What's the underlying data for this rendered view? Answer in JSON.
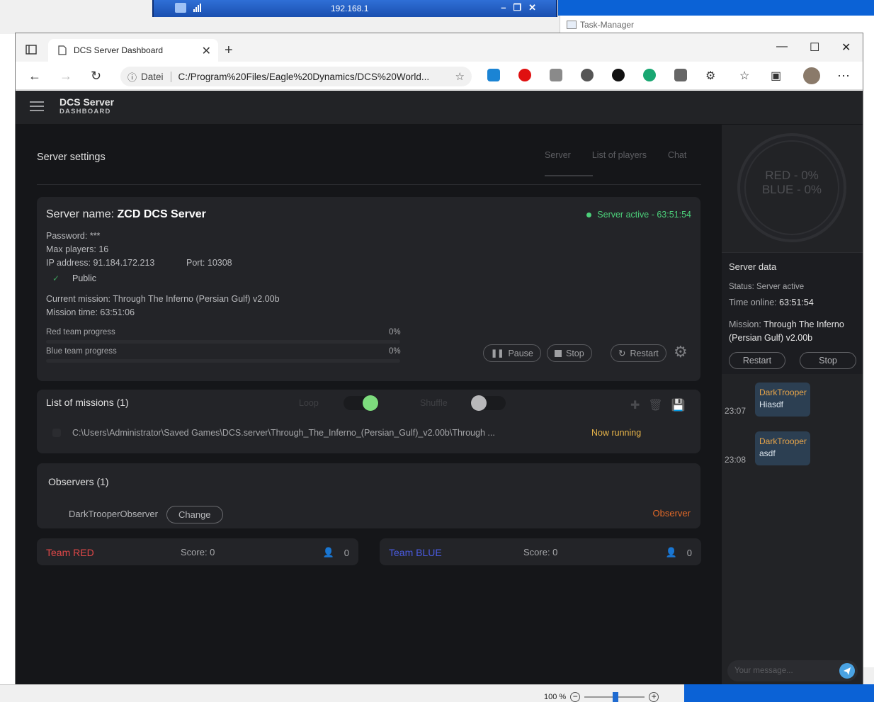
{
  "remote_bar": {
    "ip": "192.168.1"
  },
  "task_manager": {
    "title": "Task-Manager"
  },
  "browser": {
    "tab_title": "DCS Server Dashboard",
    "address_prefix": "Datei",
    "url": "C:/Program%20Files/Eagle%20Dynamics/DCS%20World...",
    "zoom": "100 %"
  },
  "app": {
    "brand_title": "DCS Server",
    "brand_subtitle": "DASHBOARD",
    "page_title": "Server settings",
    "tabs": [
      {
        "label": "Server",
        "active": true
      },
      {
        "label": "List of players",
        "active": false
      },
      {
        "label": "Chat",
        "active": false
      }
    ]
  },
  "server": {
    "name_label": "Server name:",
    "name": "ZCD DCS Server",
    "status": "Server active - 63:51:54",
    "password": "Password: ***",
    "max_players": "Max players: 16",
    "ip": "IP address: 91.184.172.213",
    "port": "Port: 10308",
    "public_label": "Public",
    "current_mission": "Current mission: Through The Inferno (Persian Gulf) v2.00b",
    "mission_time": "Mission time: 63:51:06",
    "red_progress_label": "Red team progress",
    "red_progress": "0%",
    "red_progress_value": 0,
    "blue_progress_label": "Blue team progress",
    "blue_progress": "0%",
    "blue_progress_value": 0,
    "pause_label": "Pause",
    "stop_label": "Stop",
    "restart_label": "Restart"
  },
  "missions": {
    "title": "List of missions (1)",
    "loop_label": "Loop",
    "loop_on": true,
    "shuffle_label": "Shuffle",
    "shuffle_on": false,
    "items": [
      {
        "path": "C:\\Users\\Administrator\\Saved Games\\DCS.server\\Through_The_Inferno_(Persian_Gulf)_v2.00b\\Through ...",
        "status": "Now running"
      }
    ]
  },
  "observers": {
    "title": "Observers (1)",
    "items": [
      {
        "name": "DarkTrooperObserver",
        "change_label": "Change",
        "role": "Observer"
      }
    ]
  },
  "teams": [
    {
      "name": "Team RED",
      "score": "Score: 0",
      "players": "0",
      "color": "#e04848"
    },
    {
      "name": "Team BLUE",
      "score": "Score: 0",
      "players": "0",
      "color": "#4a5be0"
    }
  ],
  "sidebar": {
    "ring_red": "RED - 0%",
    "ring_blue": "BLUE - 0%",
    "server_data_title": "Server data",
    "status": "Status: Server active",
    "time_online_label": "Time online:",
    "time_online": "63:51:54",
    "mission_label": "Mission:",
    "mission": "Through The Inferno (Persian Gulf) v2.00b",
    "restart_label": "Restart",
    "stop_label": "Stop",
    "chat": [
      {
        "author": "DarkTrooper",
        "text": "Hiasdf",
        "time": "23:07"
      },
      {
        "author": "DarkTrooper",
        "text": "asdf",
        "time": "23:08"
      }
    ],
    "chat_placeholder": "Your message..."
  },
  "colors": {
    "accent_green": "#4cd07a",
    "running": "#e8b54a",
    "observer": "#e46a28"
  }
}
